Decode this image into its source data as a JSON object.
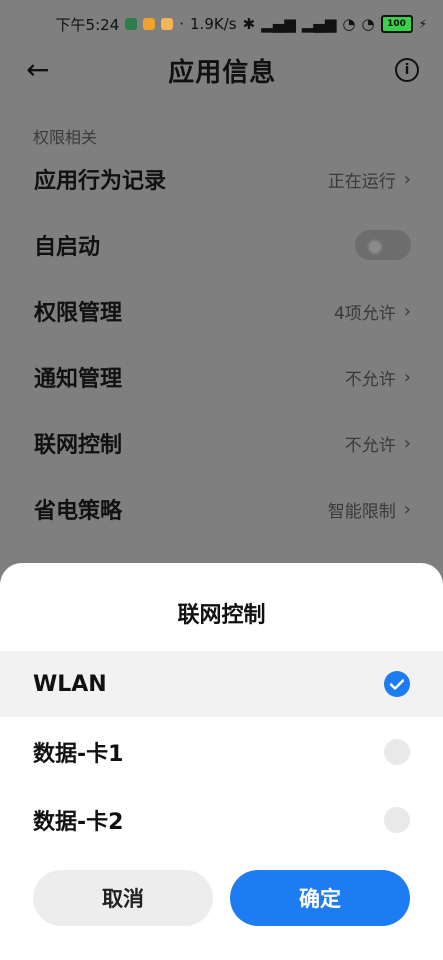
{
  "status_bar": {
    "time": "下午5:24",
    "speed": "1.9K/s",
    "battery": "100",
    "icons": [
      "notification-green-icon",
      "notification-orange-icon",
      "notification-orange2-icon",
      "bluetooth-icon",
      "hd-signal-1-icon",
      "hd-signal-2-icon",
      "wifi-icon",
      "wifi-icon",
      "battery-icon",
      "charging-icon"
    ]
  },
  "header": {
    "title": "应用信息",
    "back_icon": "back-arrow-icon",
    "info_icon": "info-icon"
  },
  "section": {
    "label": "权限相关",
    "rows": [
      {
        "label": "应用行为记录",
        "value": "正在运行",
        "type": "link"
      },
      {
        "label": "自启动",
        "value": "",
        "type": "toggle",
        "on": false
      },
      {
        "label": "权限管理",
        "value": "4项允许",
        "type": "link"
      },
      {
        "label": "通知管理",
        "value": "不允许",
        "type": "link"
      },
      {
        "label": "联网控制",
        "value": "不允许",
        "type": "link"
      },
      {
        "label": "省电策略",
        "value": "智能限制",
        "type": "link"
      }
    ]
  },
  "sheet": {
    "title": "联网控制",
    "options": [
      {
        "label": "WLAN",
        "checked": true
      },
      {
        "label": "数据-卡1",
        "checked": false
      },
      {
        "label": "数据-卡2",
        "checked": false
      }
    ],
    "cancel_label": "取消",
    "ok_label": "确定"
  },
  "colors": {
    "accent": "#1e7cf2",
    "dim_background": "#7f7f7f"
  }
}
